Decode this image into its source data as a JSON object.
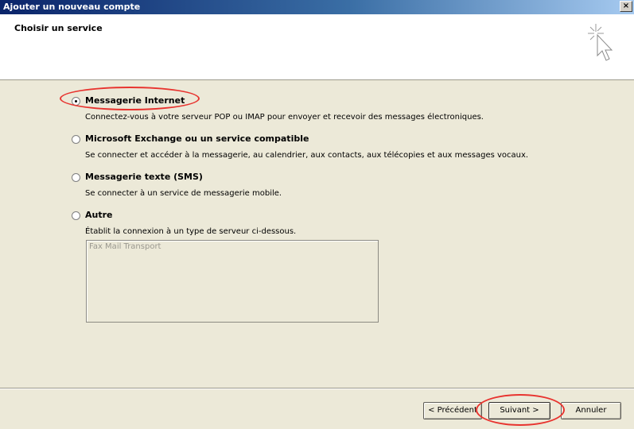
{
  "window": {
    "title": "Ajouter un nouveau compte",
    "close_label": "×"
  },
  "header": {
    "title": "Choisir un service",
    "icon": "cursor-sparkle-icon"
  },
  "options": [
    {
      "title": "Messagerie Internet",
      "description": "Connectez-vous à votre serveur POP ou IMAP pour envoyer et recevoir des messages électroniques.",
      "checked": true
    },
    {
      "title": "Microsoft Exchange ou un service compatible",
      "description": "Se connecter et accéder à la messagerie, au calendrier, aux contacts, aux télécopies et aux messages vocaux.",
      "checked": false
    },
    {
      "title": "Messagerie texte (SMS)",
      "description": "Se connecter à un service de messagerie mobile.",
      "checked": false
    },
    {
      "title": "Autre",
      "description": "Établit la connexion à un type de serveur ci-dessous.",
      "checked": false
    }
  ],
  "other_services": {
    "items": [
      "Fax Mail Transport"
    ]
  },
  "buttons": {
    "previous": "< Précédent",
    "next": "Suivant >",
    "cancel": "Annuler"
  },
  "colors": {
    "titlebar": "#0a246a",
    "highlight": "#e8342f",
    "panel": "#ece9d8"
  }
}
